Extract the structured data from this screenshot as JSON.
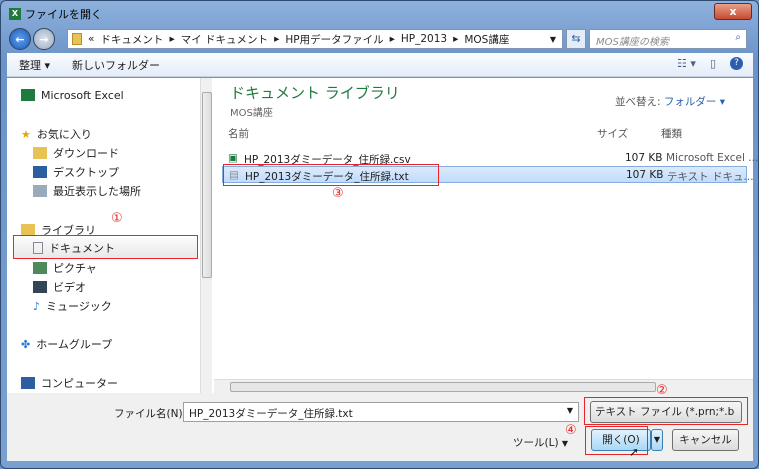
{
  "window": {
    "title": "ファイルを開く",
    "close": "x"
  },
  "address": {
    "crumbs": [
      "«",
      "ドキュメント",
      "マイ ドキュメント",
      "HP用データファイル",
      "HP_2013",
      "MOS講座"
    ],
    "search_placeholder": "MOS講座の検索"
  },
  "toolbar": {
    "organize": "整理 ▾",
    "new_folder": "新しいフォルダー"
  },
  "sidebar": {
    "items": [
      {
        "label": "Microsoft Excel",
        "icon": "excel-icon"
      },
      {
        "label": "お気に入り",
        "icon": "star-icon"
      },
      {
        "label": "ダウンロード",
        "icon": "download-folder-icon"
      },
      {
        "label": "デスクトップ",
        "icon": "desktop-icon"
      },
      {
        "label": "最近表示した場所",
        "icon": "recent-places-icon"
      },
      {
        "label": "ライブラリ",
        "icon": "library-icon"
      },
      {
        "label": "ドキュメント",
        "icon": "document-icon"
      },
      {
        "label": "ピクチャ",
        "icon": "picture-icon"
      },
      {
        "label": "ビデオ",
        "icon": "video-icon"
      },
      {
        "label": "ミュージック",
        "icon": "music-icon"
      },
      {
        "label": "ホームグループ",
        "icon": "homegroup-icon"
      },
      {
        "label": "コンピューター",
        "icon": "computer-icon"
      }
    ]
  },
  "content": {
    "library_title": "ドキュメント ライブラリ",
    "subtitle": "MOS講座",
    "sort_label": "並べ替え:",
    "sort_value": "フォルダー ▾",
    "columns": [
      "名前",
      "サイズ",
      "種類"
    ],
    "files": [
      {
        "name": "HP_2013ダミーデータ_住所録.csv",
        "size": "107 KB",
        "type": "Microsoft Excel ...",
        "icon": "excel-csv-icon"
      },
      {
        "name": "HP_2013ダミーデータ_住所録.txt",
        "size": "107 KB",
        "type": "テキスト ドキュ...",
        "icon": "text-file-icon",
        "selected": true
      }
    ]
  },
  "bottom": {
    "filename_label": "ファイル名(N):",
    "filename_value": "HP_2013ダミーデータ_住所録.txt",
    "filetype": "テキスト ファイル (*.prn;*.b",
    "tools": "ツール(L)",
    "open": "開く(O)",
    "cancel": "キャンセル"
  },
  "annotations": [
    "①",
    "②",
    "③",
    "④"
  ],
  "colors": {
    "highlight": "#e8262a",
    "accent": "#1f7a3e",
    "selection": "#c1dcfb"
  }
}
